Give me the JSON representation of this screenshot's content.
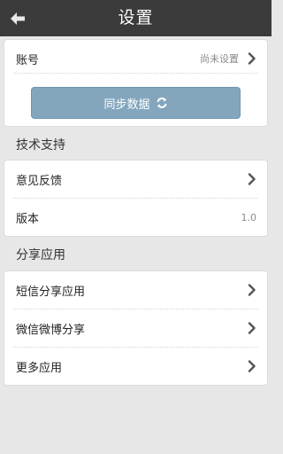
{
  "header": {
    "title": "设置"
  },
  "account": {
    "label": "账号",
    "status": "尚未设置",
    "sync_button": "同步数据"
  },
  "sections": [
    {
      "title": "技术支持",
      "items": [
        {
          "label": "意见反馈",
          "value": ""
        },
        {
          "label": "版本",
          "value": "1.0"
        }
      ]
    },
    {
      "title": "分享应用",
      "items": [
        {
          "label": "短信分享应用"
        },
        {
          "label": "微信微博分享"
        },
        {
          "label": "更多应用"
        }
      ]
    }
  ],
  "colors": {
    "header_bg": "#3b3b3b",
    "sync_button_bg": "#83a6bd",
    "page_bg": "#e7e7e7"
  }
}
